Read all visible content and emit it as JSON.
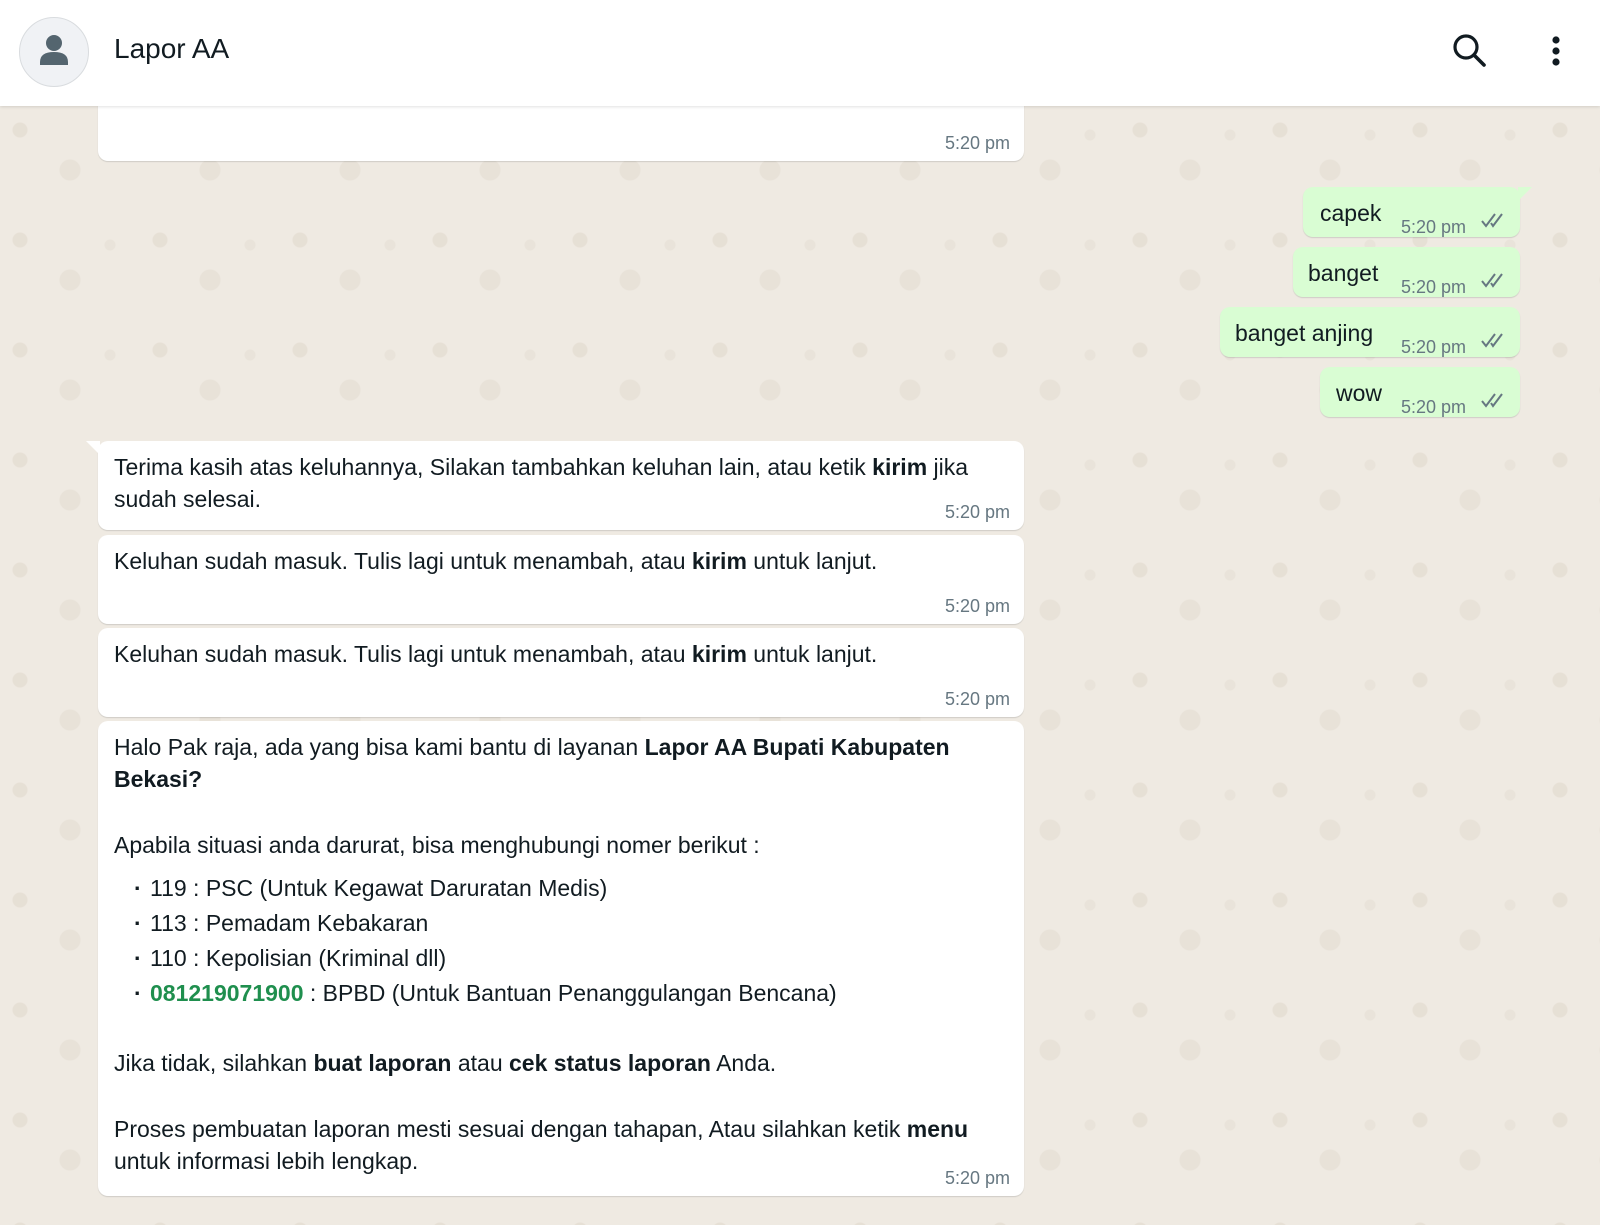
{
  "header": {
    "title": "Lapor AA",
    "avatar_icon": "person-icon",
    "search_icon": "search-icon",
    "menu_icon": "more-vertical-icon"
  },
  "outgoing_messages": [
    {
      "text": "capek",
      "time": "5:20 pm",
      "status": "read-ticks"
    },
    {
      "text": "banget",
      "time": "5:20 pm",
      "status": "read-ticks"
    },
    {
      "text": "banget anjing",
      "time": "5:20 pm",
      "status": "read-ticks"
    },
    {
      "text": "wow",
      "time": "5:20 pm",
      "status": "read-ticks"
    }
  ],
  "incoming_messages": {
    "top_partial_time": "5:20 pm",
    "thanks": {
      "pre": "Terima kasih atas keluhannya, Silakan tambahkan keluhan lain, atau ketik ",
      "bold": "kirim",
      "post": " jika sudah selesai.",
      "time": "5:20 pm"
    },
    "received_1": {
      "pre": "Keluhan sudah masuk. Tulis lagi untuk menambah, atau ",
      "bold": "kirim",
      "post": " untuk lanjut.",
      "time": "5:20 pm"
    },
    "received_2": {
      "pre": "Keluhan sudah masuk. Tulis lagi untuk menambah, atau ",
      "bold": "kirim",
      "post": " untuk lanjut.",
      "time": "5:20 pm"
    },
    "greeting": {
      "intro_pre": "Halo Pak raja, ada yang bisa kami bantu di layanan ",
      "intro_bold": "Lapor AA Bupati Kabupaten Bekasi?",
      "emergency_line": "Apabila situasi anda darurat, bisa menghubungi nomer berikut :",
      "numbers": [
        {
          "number": "119",
          "desc": " : PSC (Untuk Kegawat Daruratan Medis)"
        },
        {
          "number": "113",
          "desc": " : Pemadam Kebakaran"
        },
        {
          "number": "110",
          "desc": " : Kepolisian (Kriminal dll)"
        },
        {
          "number": "081219071900",
          "desc": " : BPBD (Untuk Bantuan Penanggulangan Bencana)"
        }
      ],
      "report_pre": "Jika tidak, silahkan ",
      "report_bold1": "buat laporan",
      "report_mid": " atau ",
      "report_bold2": "cek status laporan",
      "report_post": " Anda.",
      "process_pre": "Proses pembuatan laporan mesti sesuai dengan tahapan, Atau silahkan ketik ",
      "process_bold": "menu",
      "process_post": " untuk informasi lebih lengkap.",
      "time": "5:20 pm"
    }
  },
  "colors": {
    "outgoing_bubble": "#d9fdd3",
    "incoming_bubble": "#ffffff",
    "chat_background": "#efeae2",
    "link_green": "#1f8f4e"
  }
}
